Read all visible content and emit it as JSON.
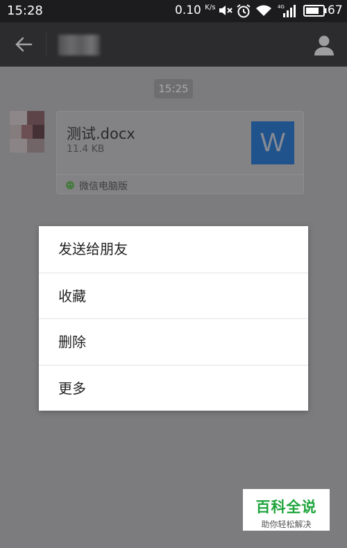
{
  "status_bar": {
    "time": "15:28",
    "net_speed": "0.10",
    "net_unit": "K/s",
    "network_type": "4G",
    "battery": "67"
  },
  "titlebar": {
    "icons": [
      "back-arrow-icon",
      "profile-icon"
    ]
  },
  "chat": {
    "timestamp": "15:25",
    "file_message": {
      "name": "测试.docx",
      "size": "11.4 KB",
      "type_letter": "W",
      "source": "微信电脑版"
    }
  },
  "context_menu": {
    "items": [
      "发送给朋友",
      "收藏",
      "删除",
      "更多"
    ]
  },
  "watermark": {
    "title": "百科全说",
    "subtitle": "助你轻松解决"
  },
  "colors": {
    "overlay_bg": "#7c7b7d",
    "status_bar": "#1c1c1e",
    "title_bar": "#2c2c2e",
    "word_icon": "#20528b",
    "watermark_green": "#1fa53c"
  }
}
